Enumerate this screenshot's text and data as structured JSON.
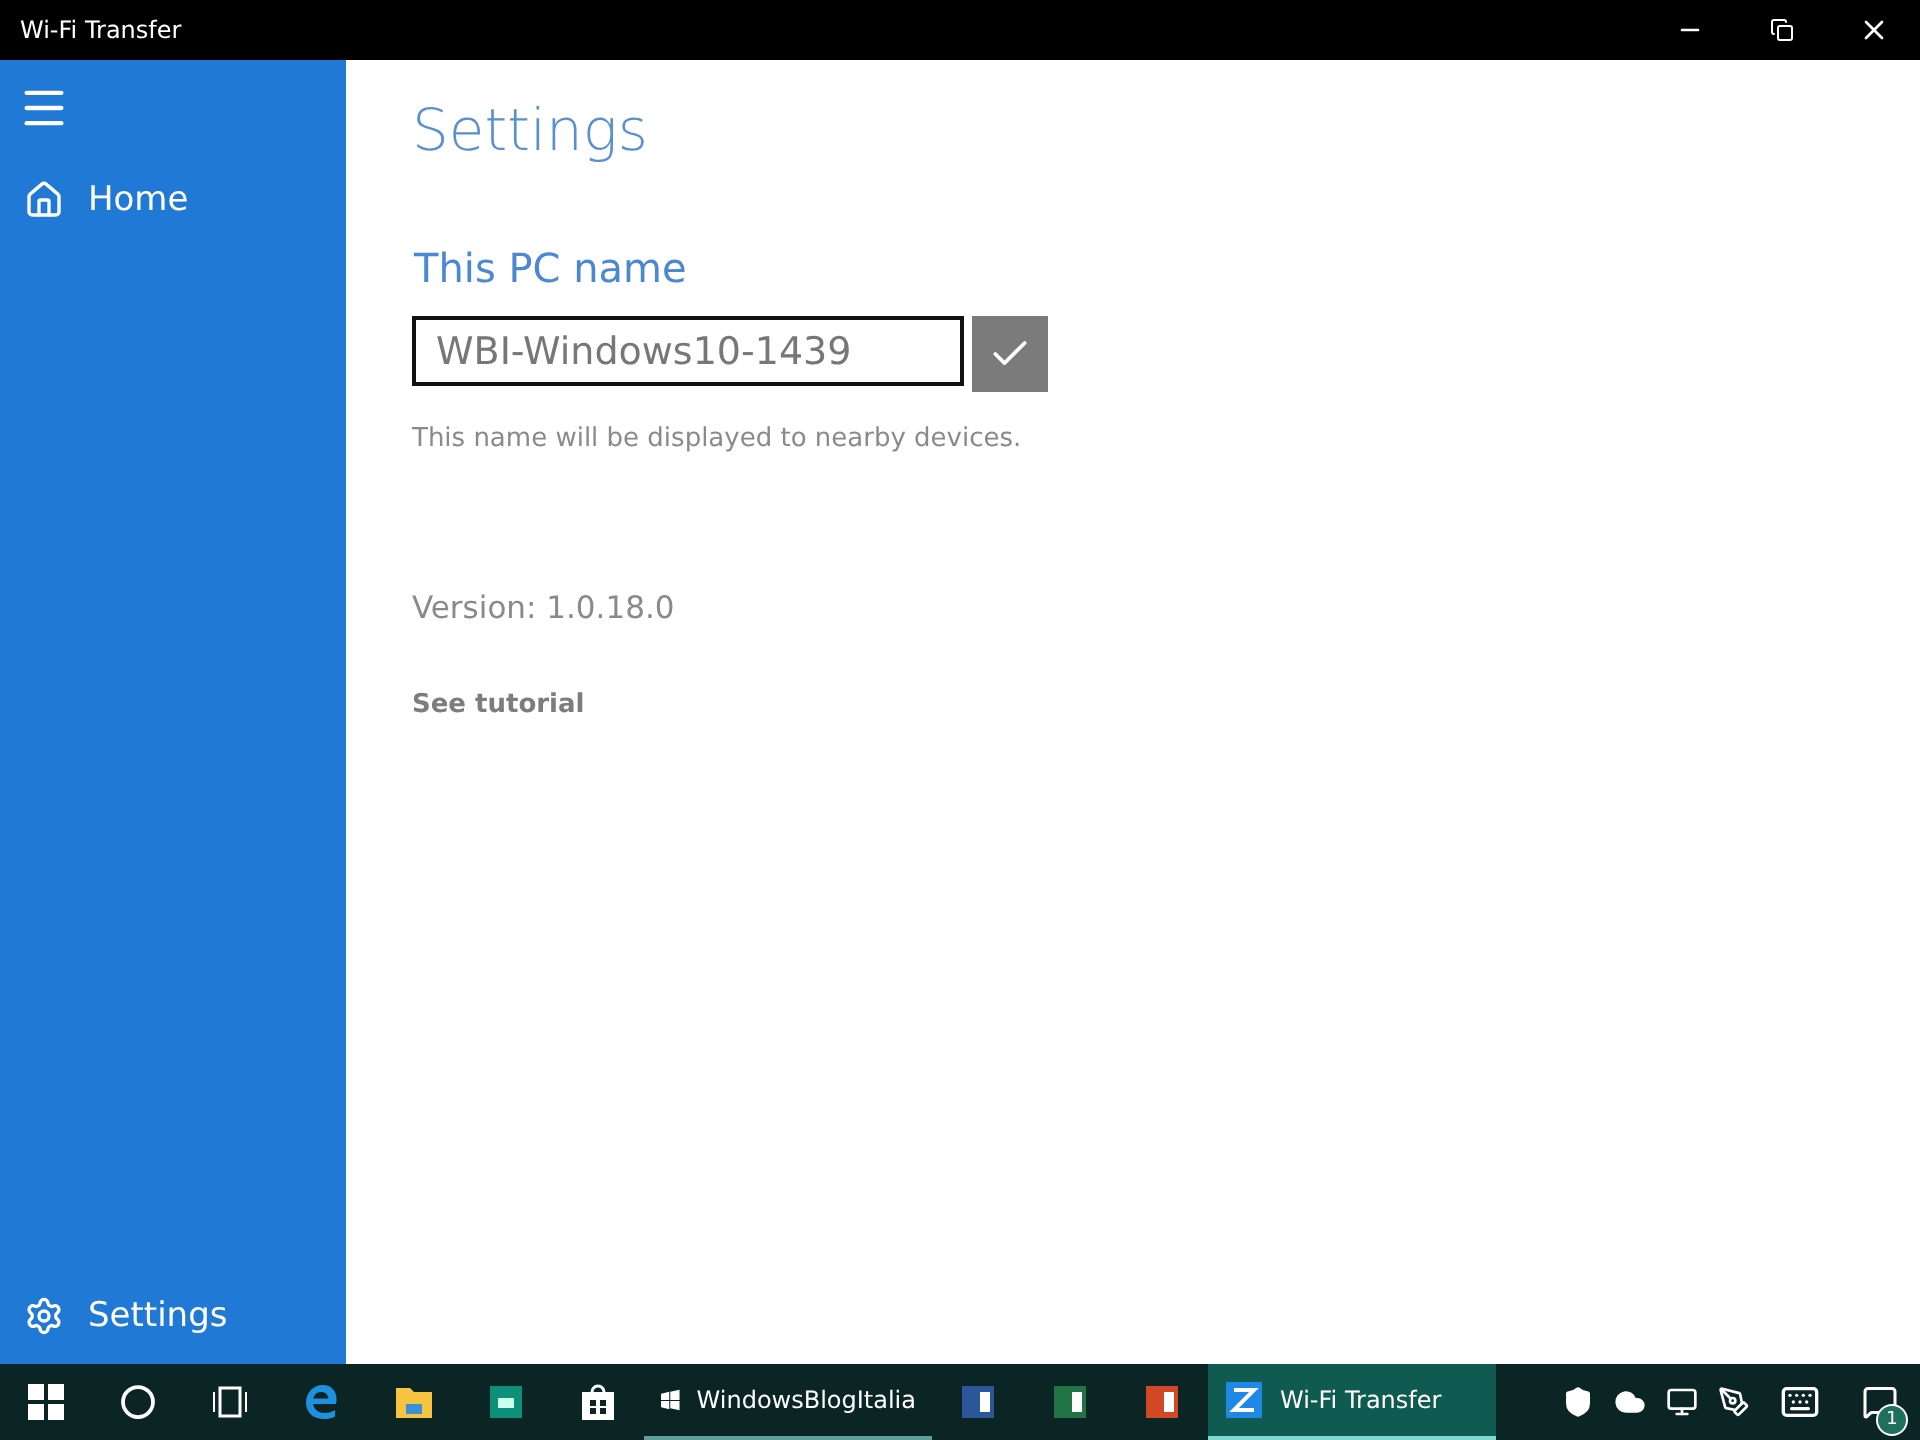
{
  "window": {
    "title": "Wi-Fi Transfer"
  },
  "sidebar": {
    "items": [
      {
        "label": "Home"
      }
    ],
    "footer_items": [
      {
        "label": "Settings"
      }
    ]
  },
  "main": {
    "heading": "Settings",
    "section_title": "This PC name",
    "name_field": {
      "value": "WBI-Windows10-1439"
    },
    "hint": "This name will be displayed to nearby devices.",
    "version": "Version: 1.0.18.0",
    "link": "See tutorial"
  },
  "taskbar": {
    "apps": [
      {
        "label": "WindowsBlogItalia",
        "selected": false
      },
      {
        "label": "Wi-Fi Transfer",
        "selected": true
      }
    ],
    "notification_count": "1"
  }
}
